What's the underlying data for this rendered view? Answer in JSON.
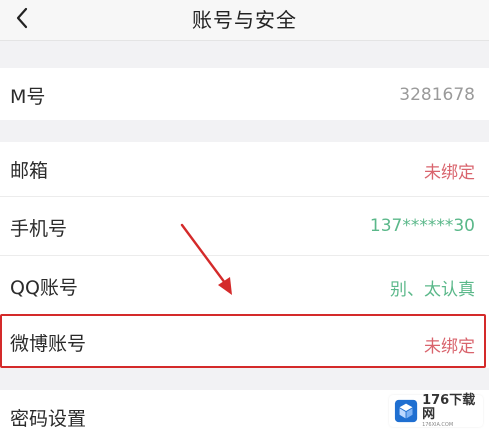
{
  "header": {
    "back_icon": "chevron-left-icon",
    "title": "账号与安全"
  },
  "rows": [
    {
      "label": "M号",
      "value": "3281678",
      "value_color": "#9a9a9a"
    },
    {
      "label": "邮箱",
      "value": "未绑定",
      "value_color": "#d9646d"
    },
    {
      "label": "手机号",
      "value": "137******30",
      "value_color": "#5bb88a"
    },
    {
      "label": "QQ账号",
      "value": "别、太认真",
      "value_color": "#5bb88a"
    },
    {
      "label": "微博账号",
      "value": "未绑定",
      "value_color": "#d9646d"
    },
    {
      "label": "密码设置",
      "value": ""
    }
  ],
  "annotation": {
    "highlight_color": "#d42a2a",
    "arrow_color": "#d42a2a"
  },
  "watermark": {
    "text": "176下载网",
    "sub": "176XIA.COM"
  }
}
